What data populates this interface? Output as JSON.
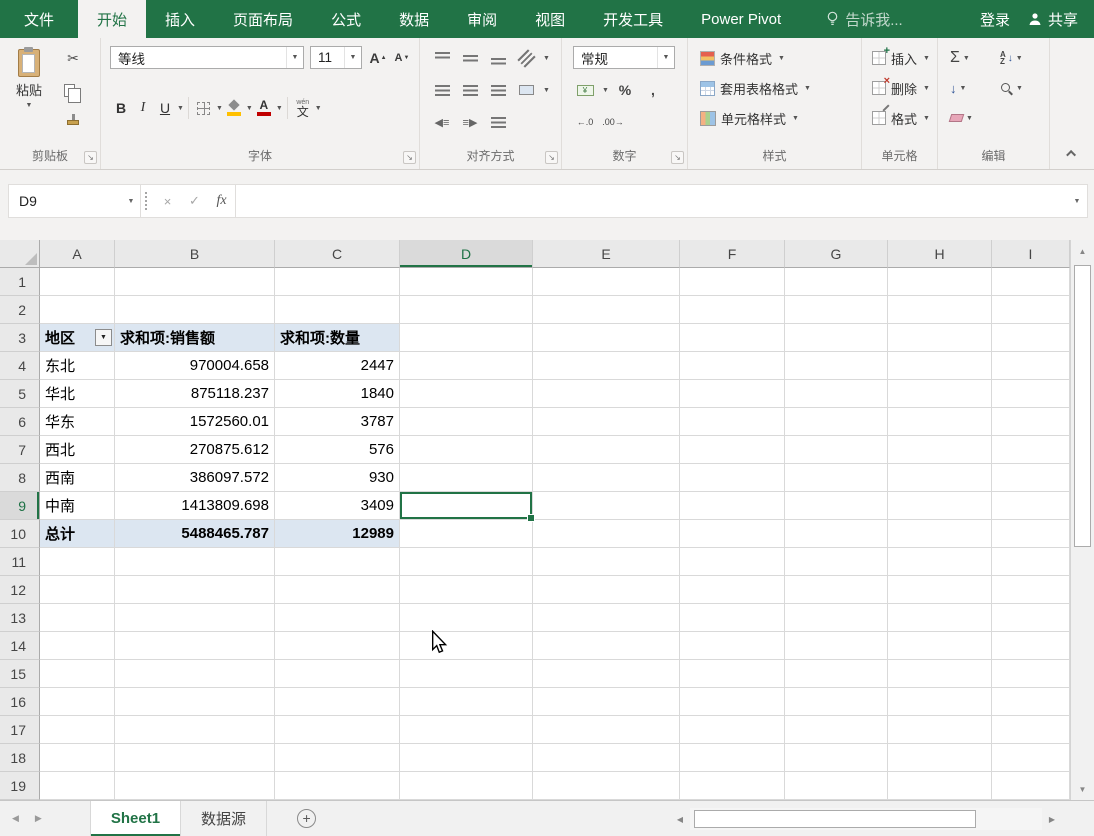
{
  "menu_tabs": [
    {
      "label": "文件"
    },
    {
      "label": "开始",
      "active": true
    },
    {
      "label": "插入"
    },
    {
      "label": "页面布局"
    },
    {
      "label": "公式"
    },
    {
      "label": "数据"
    },
    {
      "label": "审阅"
    },
    {
      "label": "视图"
    },
    {
      "label": "开发工具"
    },
    {
      "label": "Power Pivot"
    }
  ],
  "tell_me": "告诉我...",
  "account": {
    "sign_in": "登录",
    "share": "共享"
  },
  "ribbon": {
    "clipboard": {
      "label": "剪贴板",
      "paste": "粘贴"
    },
    "font": {
      "label": "字体",
      "name": "等线",
      "size": "11",
      "bold": "B",
      "italic": "I",
      "underline": "U",
      "phonetic": "文",
      "phonetic_hint": "wén"
    },
    "alignment": {
      "label": "对齐方式"
    },
    "number": {
      "label": "数字",
      "format": "常规",
      "currency": "¥",
      "percent": "%",
      "comma": ",",
      "decimal_increase": "←.0",
      "decimal_decrease": ".00→"
    },
    "styles": {
      "label": "样式",
      "conditional": "条件格式",
      "format_as_table": "套用表格格式",
      "cell_styles": "单元格样式"
    },
    "cells": {
      "label": "单元格",
      "insert": "插入",
      "delete": "删除",
      "format": "格式"
    },
    "editing": {
      "label": "编辑",
      "autosum": "Σ",
      "sort_a": "A",
      "sort_z": "Z"
    }
  },
  "formula_bar": {
    "name_box": "D9",
    "cancel": "×",
    "enter": "✓",
    "fx": "fx",
    "content": ""
  },
  "grid": {
    "columns": [
      "A",
      "B",
      "C",
      "D",
      "E",
      "F",
      "G",
      "H",
      "I"
    ],
    "first_row": 1,
    "last_row": 19,
    "active_cell": "D9"
  },
  "pivot_table": {
    "header_row": 3,
    "headers": [
      {
        "col": "A",
        "label": "地区",
        "filter": true
      },
      {
        "col": "B",
        "label": "求和项:销售额"
      },
      {
        "col": "C",
        "label": "求和项:数量"
      }
    ],
    "rows": [
      {
        "row": 4,
        "region": "东北",
        "sales": "970004.658",
        "quantity": "2447"
      },
      {
        "row": 5,
        "region": "华北",
        "sales": "875118.237",
        "quantity": "1840"
      },
      {
        "row": 6,
        "region": "华东",
        "sales": "1572560.01",
        "quantity": "3787"
      },
      {
        "row": 7,
        "region": "西北",
        "sales": "270875.612",
        "quantity": "576"
      },
      {
        "row": 8,
        "region": "西南",
        "sales": "386097.572",
        "quantity": "930"
      },
      {
        "row": 9,
        "region": "中南",
        "sales": "1413809.698",
        "quantity": "3409"
      }
    ],
    "total": {
      "row": 10,
      "label": "总计",
      "sales": "5488465.787",
      "quantity": "12989"
    }
  },
  "sheet_tabs": [
    {
      "label": "Sheet1",
      "active": true
    },
    {
      "label": "数据源",
      "active": false
    }
  ],
  "colors": {
    "excel_green": "#217346",
    "pivot_fill": "#dce6f1"
  }
}
